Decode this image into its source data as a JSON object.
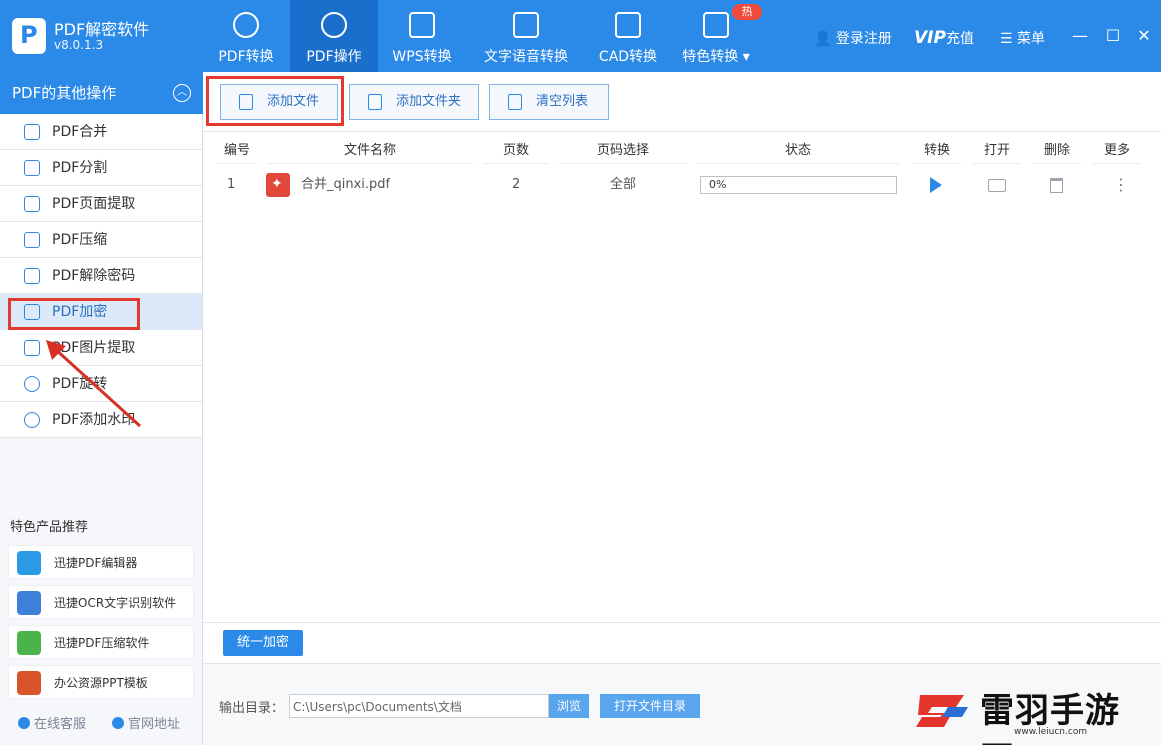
{
  "app": {
    "name": "PDF解密软件",
    "version": "v8.0.1.3"
  },
  "nav": {
    "tabs": [
      {
        "label": "PDF转换",
        "icon": "swap-icon"
      },
      {
        "label": "PDF操作",
        "icon": "gear-icon"
      },
      {
        "label": "WPS转换",
        "icon": "wps-icon"
      },
      {
        "label": "文字语音转换",
        "icon": "audio-wave-icon"
      },
      {
        "label": "CAD转换",
        "icon": "cad-icon"
      },
      {
        "label": "特色转换",
        "icon": "star-icon"
      }
    ],
    "hot_badge": "热",
    "login": "登录注册",
    "vip_brand": "VIP",
    "vip_label": "充值",
    "menu": "菜单",
    "minimize": "—",
    "maximize": "☐",
    "close": "✕"
  },
  "sidebar": {
    "header": "PDF的其他操作",
    "items": [
      {
        "label": "PDF合并",
        "icon": "merge-icon"
      },
      {
        "label": "PDF分割",
        "icon": "split-icon"
      },
      {
        "label": "PDF页面提取",
        "icon": "page-extract-icon"
      },
      {
        "label": "PDF压缩",
        "icon": "compress-icon"
      },
      {
        "label": "PDF解除密码",
        "icon": "unlock-icon"
      },
      {
        "label": "PDF加密",
        "icon": "lock-icon"
      },
      {
        "label": "PDF图片提取",
        "icon": "image-icon"
      },
      {
        "label": "PDF旋转",
        "icon": "rotate-icon"
      },
      {
        "label": "PDF添加水印",
        "icon": "add-circle-icon"
      }
    ],
    "featured_title": "特色产品推荐",
    "featured": [
      {
        "label": "迅捷PDF编辑器",
        "icon": "pdf-editor-icon",
        "color": "#2b9be8"
      },
      {
        "label": "迅捷OCR文字识别软件",
        "icon": "ocr-icon",
        "color": "#3d7fd9"
      },
      {
        "label": "迅捷PDF压缩软件",
        "icon": "zip-icon",
        "color": "#4bb34b"
      },
      {
        "label": "办公资源PPT模板",
        "icon": "ppt-icon",
        "color": "#d9532b"
      }
    ],
    "footer_service": "在线客服",
    "footer_site": "官网地址"
  },
  "toolbar": {
    "add_file": "添加文件",
    "add_folder": "添加文件夹",
    "clear_list": "清空列表"
  },
  "table": {
    "headers": [
      "编号",
      "文件名称",
      "页数",
      "页码选择",
      "状态",
      "转换",
      "打开",
      "删除",
      "更多"
    ],
    "rows": [
      {
        "index": "1",
        "name": "合并_qinxi.pdf",
        "pages": "2",
        "page_select": "全部",
        "progress": "0%"
      }
    ]
  },
  "actions": {
    "unify": "统一加密",
    "output_label": "输出目录：",
    "output_path": "C:\\Users\\pc\\Documents\\文档",
    "browse": "浏览",
    "open_dir": "打开文件目录"
  },
  "watermark": {
    "text": "雷羽手游网",
    "url": "www.leiucn.com"
  },
  "colors": {
    "primary": "#2b8ae8",
    "highlight": "#e23a2e",
    "pdf": "#e2483a"
  }
}
